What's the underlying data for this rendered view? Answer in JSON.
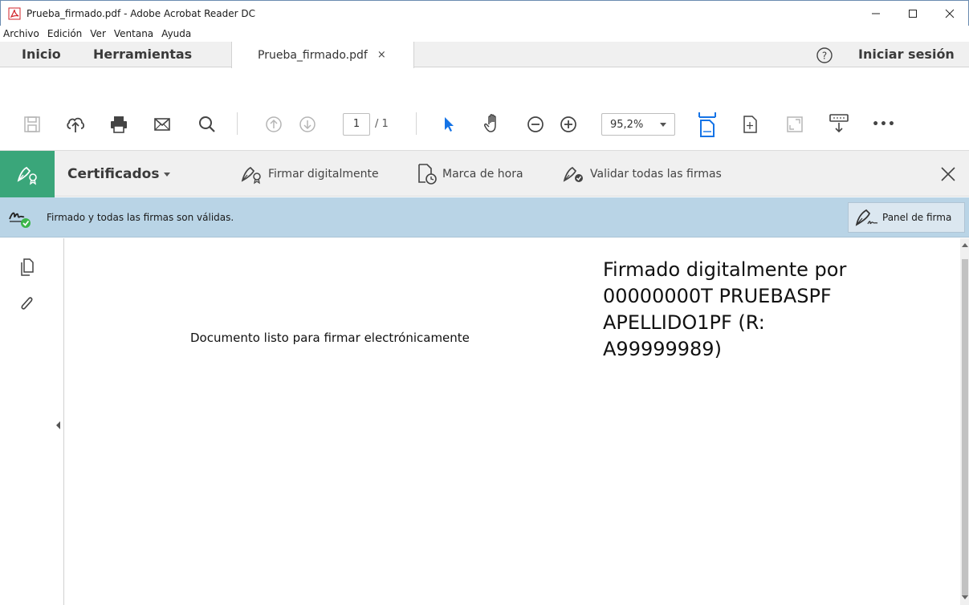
{
  "window": {
    "title": "Prueba_firmado.pdf - Adobe Acrobat Reader DC",
    "controls": [
      "minimize-icon",
      "maximize-icon",
      "close-icon"
    ]
  },
  "menu": {
    "items": [
      "Archivo",
      "Edición",
      "Ver",
      "Ventana",
      "Ayuda"
    ]
  },
  "tabs": {
    "home": "Inicio",
    "tools": "Herramientas",
    "document": "Prueba_firmado.pdf",
    "document_close": "×",
    "help_icon": "help-icon",
    "sign_in": "Iniciar sesión"
  },
  "toolbar": {
    "icons": [
      "save-icon",
      "upload-cloud-icon",
      "print-icon",
      "email-icon",
      "search-icon",
      "prev-page-icon",
      "next-page-icon",
      "select-arrow-icon",
      "hand-icon",
      "zoom-out-icon",
      "zoom-in-icon",
      "fit-width-icon",
      "page-view-icon",
      "fullscreen-icon",
      "reading-mode-icon",
      "more-icon"
    ],
    "page_current": "1",
    "page_total": "/ 1",
    "zoom": "95,2%",
    "more": "•••"
  },
  "certificates": {
    "menu_label": "Certificados",
    "sign_digitally": "Firmar digitalmente",
    "timestamp": "Marca de hora",
    "validate_all": "Validar todas las firmas"
  },
  "signature_bar": {
    "status": "Firmado y todas las firmas son válidas.",
    "panel_button": "Panel de firma"
  },
  "document": {
    "body_text": "Documento listo para firmar electrónicamente",
    "signature_lines": [
      "Firmado digitalmente por",
      "00000000T PRUEBASPF",
      "APELLIDO1PF (R:",
      "A99999989)"
    ]
  },
  "colors": {
    "accent_green": "#3aa67a",
    "signature_bar": "#b9d4e6",
    "acrobat_red": "#d2232a",
    "blue_tool": "#1473e6"
  }
}
